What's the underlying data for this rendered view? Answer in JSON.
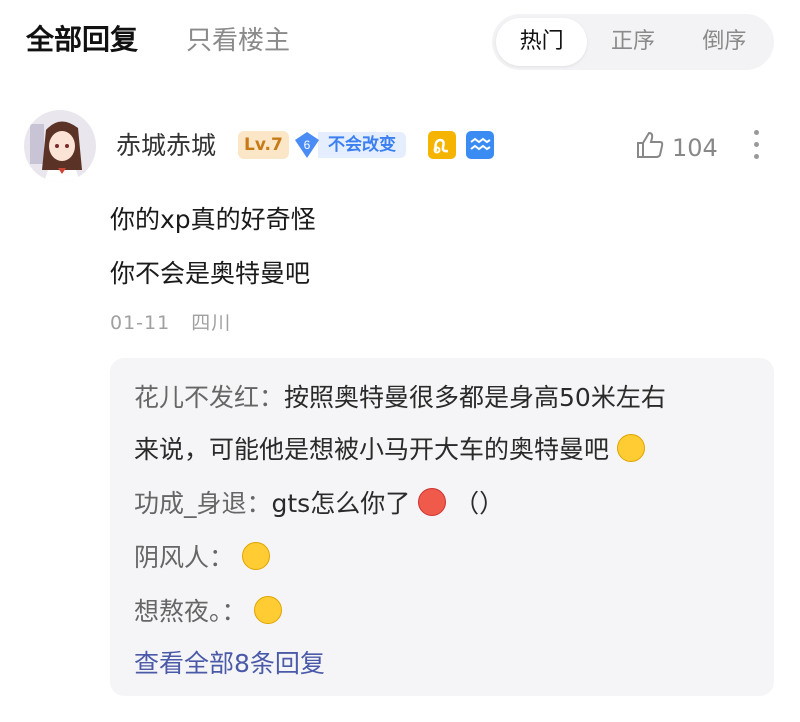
{
  "tabs": {
    "all_replies": "全部回复",
    "op_only": "只看楼主"
  },
  "sort": {
    "hot": "热门",
    "asc": "正序",
    "desc": "倒序"
  },
  "comment": {
    "username": "赤城赤城",
    "level": "Lv.7",
    "fan_level": "6",
    "fan_badge_text": "不会改变",
    "likes": "104",
    "lines": [
      "你的xp真的好奇怪",
      "你不会是奥特曼吧"
    ],
    "date": "01-11",
    "location": "四川"
  },
  "replies": [
    {
      "name": "花儿不发红：",
      "text1": "按照奥特曼很多都是身高50米左右",
      "text2": "来说，可能他是想被小马开大车的奥特曼吧",
      "emoji": "laughing-face-icon"
    },
    {
      "name": "功成_身退：",
      "text": "gts怎么你了",
      "emoji": "angry-face-icon",
      "suffix": "（）"
    },
    {
      "name": "阴风人：",
      "text": "",
      "emoji": "laughing-face-icon"
    },
    {
      "name": "想熬夜。：",
      "text": "",
      "emoji": "laughing-face-icon"
    }
  ],
  "view_all": "查看全部8条回复",
  "colors": {
    "accent_link": "#4a5aa8",
    "level_badge": "#fbe7c8",
    "fan_badge": "#e4eeff"
  }
}
